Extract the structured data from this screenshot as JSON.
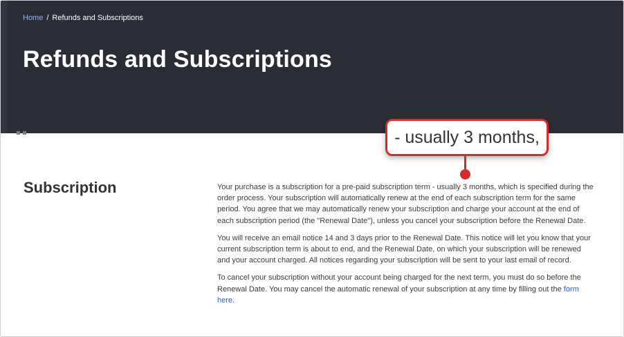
{
  "breadcrumb": {
    "home": "Home",
    "separator": "/",
    "current": "Refunds and Subscriptions"
  },
  "hero": {
    "title": "Refunds and Subscriptions"
  },
  "callout": {
    "text": "- usually 3 months,"
  },
  "section": {
    "title": "Subscription",
    "paragraphs": [
      "Your purchase is a subscription for a pre-paid subscription term - usually 3 months, which is specified during the order process. Your subscription will automatically renew at the end of each subscription term for the same period. You agree that we may automatically renew your subscription and charge your account at the end of each subscription period (the \"Renewal Date\"), unless you cancel your subscription before the Renewal Date.",
      "You will receive an email notice 14 and 3 days prior to the Renewal Date. This notice will let you know that your current subscription term is about to end, and the Renewal Date, on which your subscription will be renewed and your account charged. All notices regarding your subscription will be sent to your last email of record."
    ],
    "paragraph3_text": "To cancel your subscription without your account being charged for the next term, you must do so before the Renewal Date. You may cancel the automatic renewal of your subscription at any time by filling out the ",
    "form_link": "form here",
    "paragraph3_end": "."
  },
  "colors": {
    "hero_bg": "#2b2d36",
    "link": "#2a5bd7",
    "callout_accent": "#d62b2b"
  }
}
